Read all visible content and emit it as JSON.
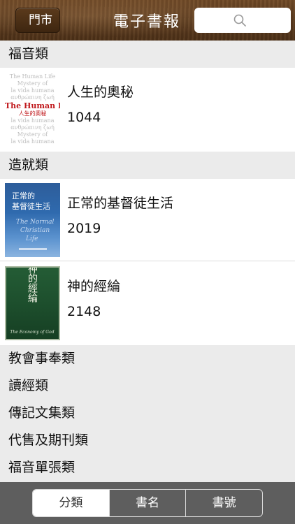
{
  "header": {
    "back_label": "門市",
    "title": "電子書報",
    "search_icon": "search-icon"
  },
  "sections": [
    {
      "title": "福音類",
      "books": [
        {
          "title": "人生的奧秘",
          "code": "1044",
          "cover_icon": "book-cover-human-life"
        }
      ]
    },
    {
      "title": "造就類",
      "books": [
        {
          "title": "正常的基督徒生活",
          "code": "2019",
          "cover_icon": "book-cover-normal-christian-life"
        },
        {
          "title": "神的經綸",
          "code": "2148",
          "cover_icon": "book-cover-economy-of-god"
        }
      ]
    }
  ],
  "categories": [
    "教會事奉類",
    "讀經類",
    "傳記文集類",
    "代售及期刊類",
    "福音單張類"
  ],
  "tabs": [
    {
      "label": "分類",
      "active": true
    },
    {
      "label": "書名",
      "active": false
    },
    {
      "label": "書號",
      "active": false
    }
  ],
  "covers": {
    "human_life": {
      "lines": [
        "The Human Life",
        "人生的奧秘",
        "Mystery of",
        "la vida humana",
        "ανθρώπινη ζωή"
      ],
      "headline": "The Human Life",
      "headline_cn": "人生的奧秘"
    },
    "normal_life": {
      "cn_line1": "正常的",
      "cn_line2": "基督徒生活",
      "en_lines": [
        "The Normal",
        "Christian",
        "Life"
      ]
    },
    "economy": {
      "cn_title": "神的經綸",
      "en_title": "The Economy of God"
    }
  },
  "colors": {
    "header_wood": "#5a3a1e",
    "section_bg": "#ebebeb",
    "bottom_bar": "#5e5e5e",
    "accent_red": "#c0181c"
  }
}
